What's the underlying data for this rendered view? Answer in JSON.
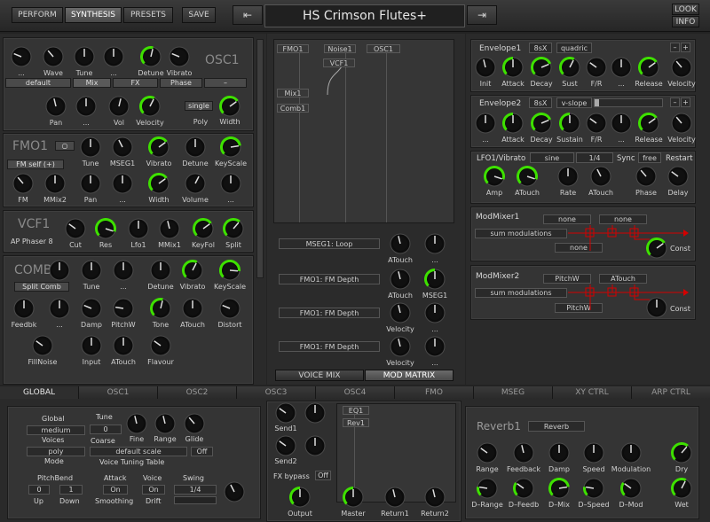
{
  "top": {
    "perform": "PERFORM",
    "synthesis": "SYNTHESIS",
    "presets": "PRESETS",
    "save": "SAVE",
    "preset_name": "HS Crimson Flutes+",
    "look": "LOOK",
    "info": "INFO"
  },
  "colors": {
    "accent": "#3ee000",
    "bg": "#232323",
    "panel": "#343434"
  },
  "icons": {
    "prev": "arrow-left-icon",
    "next": "arrow-right-icon"
  },
  "osc1": {
    "title": "OSC1",
    "r1": [
      "...",
      "Wave",
      "Tune",
      "...",
      "Detune",
      "Vibrato"
    ],
    "sel": [
      "default",
      "Mix",
      "FX",
      "Phase",
      "–"
    ],
    "r2": [
      "Pan",
      "...",
      "Vol",
      "Velocity",
      "Poly",
      "Width"
    ],
    "poly": "single"
  },
  "fmo1": {
    "title": "FMO1",
    "sel": "FM self (+)",
    "r1": [
      "Tune",
      "MSEG1",
      "Vibrato",
      "Detune",
      "KeyScale"
    ],
    "r2": [
      "FM",
      "MMix2",
      "Pan",
      "...",
      "Width",
      "Volume",
      "..."
    ]
  },
  "vcf1": {
    "title": "VCF1",
    "sub": "AP Phaser 8",
    "r1": [
      "Cut",
      "Res",
      "Lfo1",
      "MMix1",
      "KeyFol",
      "Split"
    ]
  },
  "comb1": {
    "title": "COMB1",
    "sel": "Split Comb",
    "r1": [
      "Tune",
      "...",
      "Detune",
      "Vibrato",
      "KeyScale"
    ],
    "r2": [
      "Feedbk",
      "...",
      "Damp",
      "PitchW",
      "Tone",
      "ATouch",
      "Distort"
    ],
    "r3": [
      "FillNoise",
      "Input",
      "ATouch",
      "Flavour"
    ]
  },
  "matrix": {
    "tags": [
      "FMO1",
      "Noise1",
      "OSC1",
      "VCF1",
      "Mix1",
      "Comb1"
    ],
    "slots": [
      "MSEG1: Loop",
      "FMO1: FM Depth",
      "FMO1: FM Depth",
      "FMO1: FM Depth"
    ],
    "kl": [
      "ATouch",
      "...",
      "ATouch",
      "MSEG1",
      "Velocity",
      "...",
      "Velocity",
      "..."
    ],
    "voice_mix": "VOICE MIX",
    "mod_matrix": "MOD MATRIX"
  },
  "env1": {
    "title": "Envelope1",
    "mode": "8sX",
    "curve": "quadric",
    "minus": "–",
    "plus": "+",
    "labels": [
      "Init",
      "Attack",
      "Decay",
      "Sust",
      "F/R",
      "...",
      "Release",
      "Velocity"
    ]
  },
  "env2": {
    "title": "Envelope2",
    "mode": "8sX",
    "curve": "v-slope",
    "labels": [
      "...",
      "Attack",
      "Decay",
      "Sustain",
      "F/R",
      "...",
      "Release",
      "Velocity"
    ]
  },
  "lfo1": {
    "title": "LFO1/Vibrato",
    "wave": "sine",
    "rate": "1/4",
    "sync": "Sync",
    "sync_val": "free",
    "restart": "Restart",
    "labels": [
      "Amp",
      "ATouch",
      "Rate",
      "ATouch",
      "Phase",
      "Delay"
    ]
  },
  "mm1": {
    "title": "ModMixer1",
    "s1": "none",
    "s2": "none",
    "mode": "sum modulations",
    "s3": "none",
    "const": "Const"
  },
  "mm2": {
    "title": "ModMixer2",
    "s1": "PitchW",
    "s2": "ATouch",
    "mode": "sum modulations",
    "s3": "PitchW",
    "const": "Const"
  },
  "tabs": [
    "GLOBAL",
    "OSC1",
    "OSC2",
    "OSC3",
    "OSC4",
    "FMO",
    "MSEG",
    "XY CTRL",
    "ARP CTRL"
  ],
  "global": {
    "global": "Global",
    "global_val": "medium",
    "voices": "Voices",
    "voices_val": "poly",
    "mode": "Mode",
    "tune": "Tune",
    "tune_val": "0",
    "coarse": "Coarse",
    "fine": "Fine",
    "range": "Range",
    "glide": "Glide",
    "scale": "default scale",
    "scale_off": "Off",
    "vtt": "Voice Tuning Table",
    "pb": "PitchBend",
    "pb_up": "0",
    "pb_down": "1",
    "up": "Up",
    "down": "Down",
    "attack": "Attack",
    "attack_val": "On",
    "smoothing": "Smoothing",
    "voice": "Voice",
    "voice_val": "On",
    "drift": "Drift",
    "swing": "Swing",
    "swing_val": "1/4"
  },
  "fx": {
    "send1": "Send1",
    "send2": "Send2",
    "bypass": "FX bypass",
    "bypass_val": "Off",
    "output": "Output",
    "master": "Master",
    "return1": "Return1",
    "return2": "Return2",
    "eq1": "EQ1",
    "rev1": "Rev1"
  },
  "reverb": {
    "title": "Reverb1",
    "type": "Reverb",
    "r1": [
      "Range",
      "Feedback",
      "Damp",
      "Speed",
      "Modulation",
      "Dry"
    ],
    "r2": [
      "D–Range",
      "D–Feedb",
      "D–Mix",
      "D–Speed",
      "D–Mod",
      "Wet"
    ]
  }
}
